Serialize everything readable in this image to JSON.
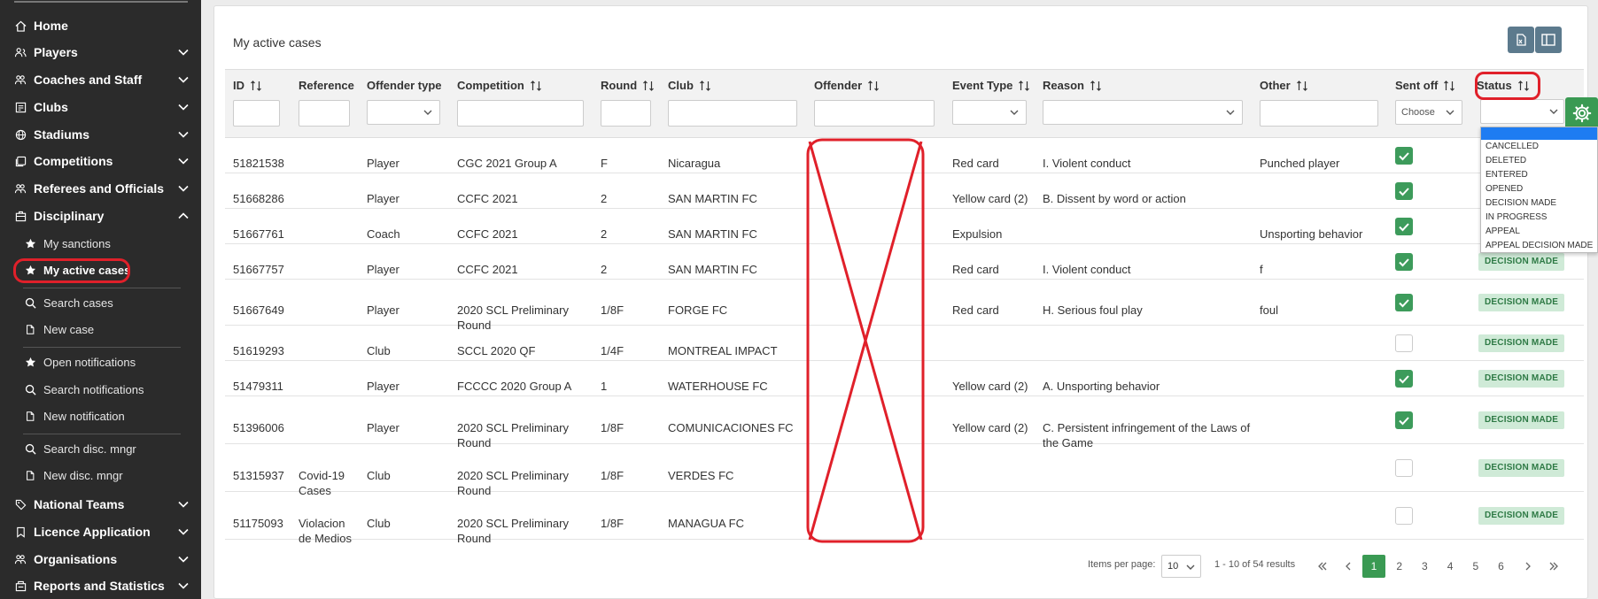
{
  "sidebar": {
    "items": [
      {
        "label": "Home",
        "icon": "home-icon",
        "expandable": false
      },
      {
        "label": "Players",
        "icon": "players-icon",
        "expandable": true
      },
      {
        "label": "Coaches and Staff",
        "icon": "coaches-icon",
        "expandable": true
      },
      {
        "label": "Clubs",
        "icon": "clubs-icon",
        "expandable": true
      },
      {
        "label": "Stadiums",
        "icon": "globe-icon",
        "expandable": true
      },
      {
        "label": "Competitions",
        "icon": "competitions-icon",
        "expandable": true
      },
      {
        "label": "Referees and Officials",
        "icon": "referees-icon",
        "expandable": true
      },
      {
        "label": "Disciplinary",
        "icon": "disciplinary-icon",
        "expandable": true,
        "expanded": true
      },
      {
        "label": "National Teams",
        "icon": "tag-icon",
        "expandable": true
      },
      {
        "label": "Licence Application",
        "icon": "bookmark-icon",
        "expandable": true
      },
      {
        "label": "Organisations",
        "icon": "organisations-icon",
        "expandable": true
      },
      {
        "label": "Reports and Statistics",
        "icon": "reports-icon",
        "expandable": true
      }
    ],
    "disciplinary_sub": [
      {
        "label": "My sanctions",
        "icon": "star-icon"
      },
      {
        "label": "My active cases",
        "icon": "star-icon",
        "active": true
      },
      {
        "label": "Search cases",
        "icon": "search-icon"
      },
      {
        "label": "New case",
        "icon": "document-icon"
      },
      {
        "label": "Open notifications",
        "icon": "star-icon"
      },
      {
        "label": "Search notifications",
        "icon": "search-icon"
      },
      {
        "label": "New notification",
        "icon": "document-icon"
      },
      {
        "label": "Search disc. mngr",
        "icon": "search-icon"
      },
      {
        "label": "New disc. mngr",
        "icon": "document-icon"
      }
    ]
  },
  "panel": {
    "title": "My active cases"
  },
  "table": {
    "columns": [
      {
        "label": "ID",
        "sortable": true
      },
      {
        "label": "Reference",
        "sortable": false
      },
      {
        "label": "Offender type",
        "sortable": false
      },
      {
        "label": "Competition",
        "sortable": true
      },
      {
        "label": "Round",
        "sortable": true
      },
      {
        "label": "Club",
        "sortable": true
      },
      {
        "label": "Offender",
        "sortable": true
      },
      {
        "label": "Event Type",
        "sortable": true
      },
      {
        "label": "Reason",
        "sortable": true
      },
      {
        "label": "Other",
        "sortable": true
      },
      {
        "label": "Sent off",
        "sortable": true
      },
      {
        "label": "Status",
        "sortable": true
      }
    ],
    "sent_off_placeholder": "Choose",
    "rows": [
      {
        "id": "51821538",
        "reference": "",
        "offender_type": "Player",
        "competition": "CGC 2021 Group A",
        "round": "F",
        "club": "Nicaragua",
        "event_type": "Red card",
        "reason": "I. Violent conduct",
        "other": "Punched player",
        "sent_off": true,
        "status": ""
      },
      {
        "id": "51668286",
        "reference": "",
        "offender_type": "Player",
        "competition": "CCFC 2021",
        "round": "2",
        "club": "SAN MARTIN FC",
        "event_type": "Yellow card (2)",
        "reason": "B. Dissent by word or action",
        "other": "",
        "sent_off": true,
        "status": ""
      },
      {
        "id": "51667761",
        "reference": "",
        "offender_type": "Coach",
        "competition": "CCFC 2021",
        "round": "2",
        "club": "SAN MARTIN FC",
        "event_type": "Expulsion",
        "reason": "",
        "other": "Unsporting behavior",
        "sent_off": true,
        "status": ""
      },
      {
        "id": "51667757",
        "reference": "",
        "offender_type": "Player",
        "competition": "CCFC 2021",
        "round": "2",
        "club": "SAN MARTIN FC",
        "event_type": "Red card",
        "reason": "I. Violent conduct",
        "other": "f",
        "sent_off": true,
        "status": "DECISION MADE"
      },
      {
        "id": "51667649",
        "reference": "",
        "offender_type": "Player",
        "competition": "2020 SCL Preliminary Round",
        "round": "1/8F",
        "club": "FORGE FC",
        "event_type": "Red card",
        "reason": "H. Serious foul play",
        "other": "foul",
        "sent_off": true,
        "status": "DECISION MADE"
      },
      {
        "id": "51619293",
        "reference": "",
        "offender_type": "Club",
        "competition": "SCCL 2020 QF",
        "round": "1/4F",
        "club": "MONTREAL IMPACT",
        "event_type": "",
        "reason": "",
        "other": "",
        "sent_off": false,
        "status": "DECISION MADE"
      },
      {
        "id": "51479311",
        "reference": "",
        "offender_type": "Player",
        "competition": "FCCCC 2020 Group A",
        "round": "1",
        "club": "WATERHOUSE FC",
        "event_type": "Yellow card (2)",
        "reason": "A. Unsporting behavior",
        "other": "",
        "sent_off": true,
        "status": "DECISION MADE"
      },
      {
        "id": "51396006",
        "reference": "",
        "offender_type": "Player",
        "competition": "2020 SCL Preliminary Round",
        "round": "1/8F",
        "club": "COMUNICACIONES FC",
        "event_type": "Yellow card (2)",
        "reason": "C. Persistent infringement of the Laws of the Game",
        "other": "",
        "sent_off": true,
        "status": "DECISION MADE"
      },
      {
        "id": "51315937",
        "reference": "Covid-19 Cases",
        "offender_type": "Club",
        "competition": "2020 SCL Preliminary Round",
        "round": "1/8F",
        "club": "VERDES FC",
        "event_type": "",
        "reason": "",
        "other": "",
        "sent_off": false,
        "status": "DECISION MADE"
      },
      {
        "id": "51175093",
        "reference": "Violacion de Medios",
        "offender_type": "Club",
        "competition": "2020 SCL Preliminary Round",
        "round": "1/8F",
        "club": "MANAGUA FC",
        "event_type": "",
        "reason": "",
        "other": "",
        "sent_off": false,
        "status": "DECISION MADE"
      }
    ]
  },
  "status_dropdown": {
    "options": [
      "CANCELLED",
      "DELETED",
      "ENTERED",
      "OPENED",
      "DECISION MADE",
      "IN PROGRESS",
      "APPEAL",
      "APPEAL DECISION MADE"
    ]
  },
  "pagination": {
    "items_per_page_label": "Items per page:",
    "items_per_page": "10",
    "range_text": "1 - 10 of 54 results",
    "pages": [
      "1",
      "2",
      "3",
      "4",
      "5",
      "6"
    ],
    "current_page": "1"
  },
  "colors": {
    "sidebar_bg": "#2b2b2b",
    "highlight": "#e0202a",
    "accent_green": "#3a9a53",
    "badge_bg": "#cfead7",
    "badge_text": "#2e7a45"
  }
}
